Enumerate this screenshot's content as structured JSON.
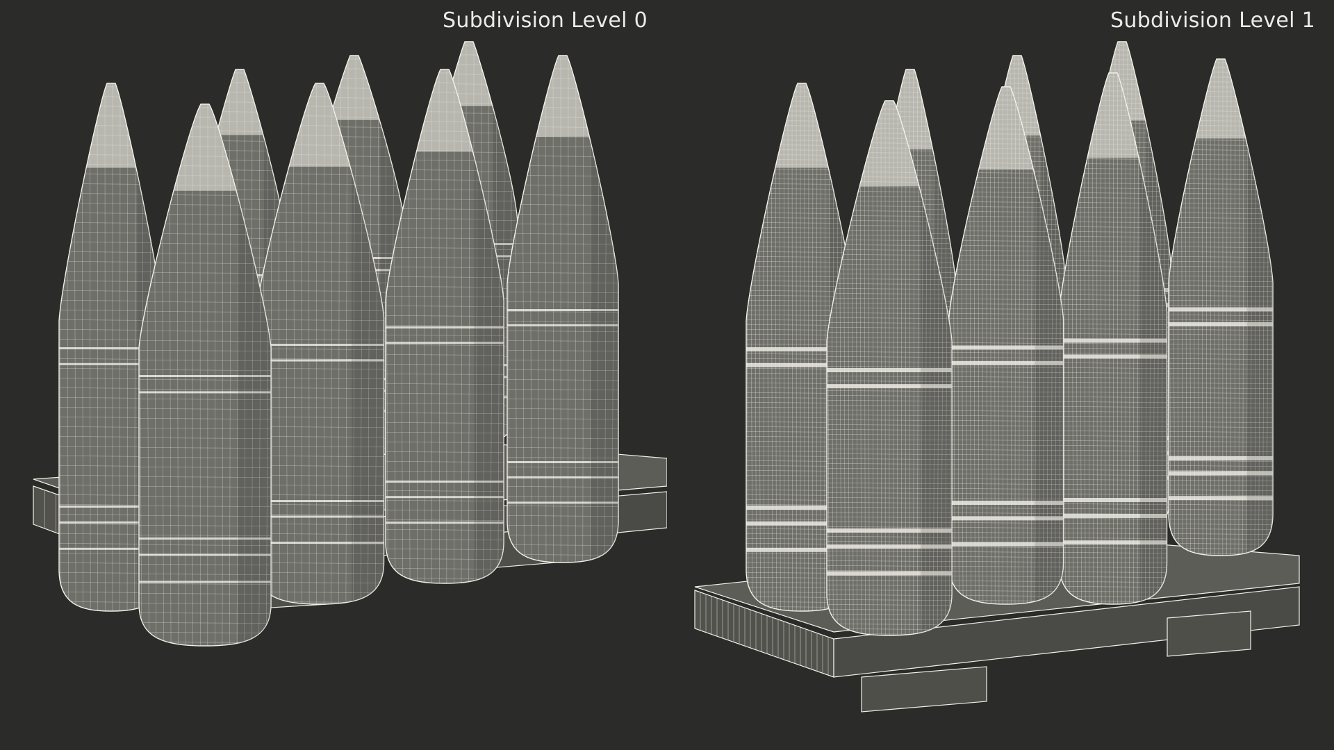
{
  "views": [
    {
      "label": "Subdivision Level 0"
    },
    {
      "label": "Subdivision Level 1"
    }
  ],
  "render": {
    "background": "#2b2b2a",
    "shell_fill": "#6f6f6a",
    "wire_color": "#f2f1e8",
    "pallet_fill": "#5d5d58"
  }
}
